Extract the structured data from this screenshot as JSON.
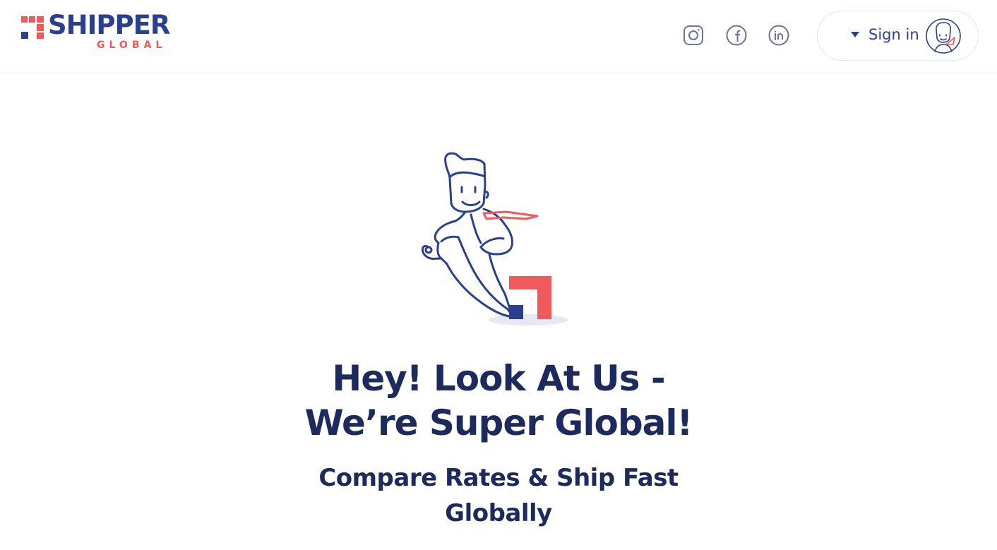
{
  "header": {
    "logo": {
      "word": "SHIPPER",
      "sub": "GLOBAL"
    },
    "social": [
      {
        "icon": "instagram-icon"
      },
      {
        "icon": "facebook-icon"
      },
      {
        "icon": "linkedin-icon"
      }
    ],
    "signin": {
      "label": "Sign in",
      "caret_icon": "caret-down-icon",
      "avatar_icon": "mascot-avatar-icon"
    }
  },
  "hero": {
    "illustration": "mascot-with-logo-illustration",
    "headline_line1": "Hey! Look At Us -",
    "headline_line2": "We’re Super Global!",
    "subhead_line1": "Compare Rates & Ship Fast",
    "subhead_line2": "Globally"
  },
  "colors": {
    "navy": "#2b3f8f",
    "red": "#f15a5a",
    "text": "#1c2a5e",
    "icon_gray": "#6b7396"
  }
}
